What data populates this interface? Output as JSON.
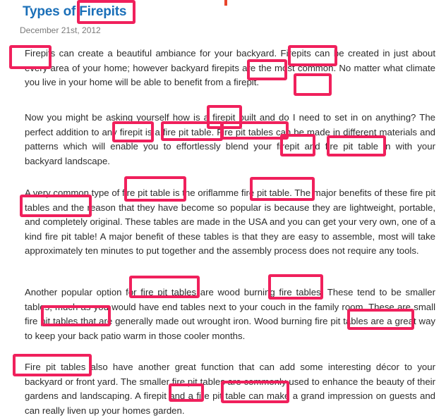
{
  "article": {
    "title": "Types of Firepits",
    "date": "December 21st, 2012",
    "paragraphs": [
      "Firepits can create a beautiful ambiance for your backyard. Firepits can be created in just about every area of your home; however backyard firepits are the most common. No matter what climate you live in your home will be able to benefit from a firepit.",
      "Now you might be asking yourself how is a firepit built and do I need to set in on anything? The perfect addition to any firepit is a fire pit table. Fire pit tables can be made in different materials and patterns which will enable you to effortlessly blend your firepit and fire pit table in with your backyard landscape.",
      "A very common type of fire pit table is the oriflamme fire pit table. The major benefits of these fire pit tables and the reason that they have become so popular is because they are lightweight, portable, and completely original. These tables are made in the USA and you can get your very own, one of a kind fire pit table! A major benefit of these tables is that they are easy to assemble, most will take approximately ten minutes to put together and the assembly process does not require any tools.",
      "Another popular option for fire pit tables are wood burning fire tables. These tend to be smaller tables, much as you would have end tables next to your couch in the family room. These are small fire pit tables that are generally made out wrought iron. Wood burning fire pit tables are a great way to keep your back patio warm in those cooler months.",
      "Fire pit tables also have another great function that can add some interesting décor to your backyard or front yard. The smaller fire pit tables are commonly used to enhance the beauty of their gardens and landscaping. A firepit and a fire pit table can make a grand impression on guests and can really liven up your homes garden."
    ]
  },
  "highlights": {
    "color": "#f0205c",
    "keywords": [
      "Firepits",
      "Firepits",
      "Firepits",
      "firepits",
      "firepit.",
      "firepit",
      "firepit",
      "fire pit table",
      "Fire pit tables",
      "firepit",
      "fire pit table",
      "fire pit table",
      "fire pit table.",
      "fire pit tables",
      "fire pit tables",
      "fire tables.",
      "fire pit tables",
      "fire pit tables",
      "Fire pit tables",
      "firepit",
      "fire pit table"
    ]
  },
  "colors": {
    "title": "#1a6fb8",
    "date": "#7a7a7a",
    "body_text": "#2b2b2b"
  }
}
